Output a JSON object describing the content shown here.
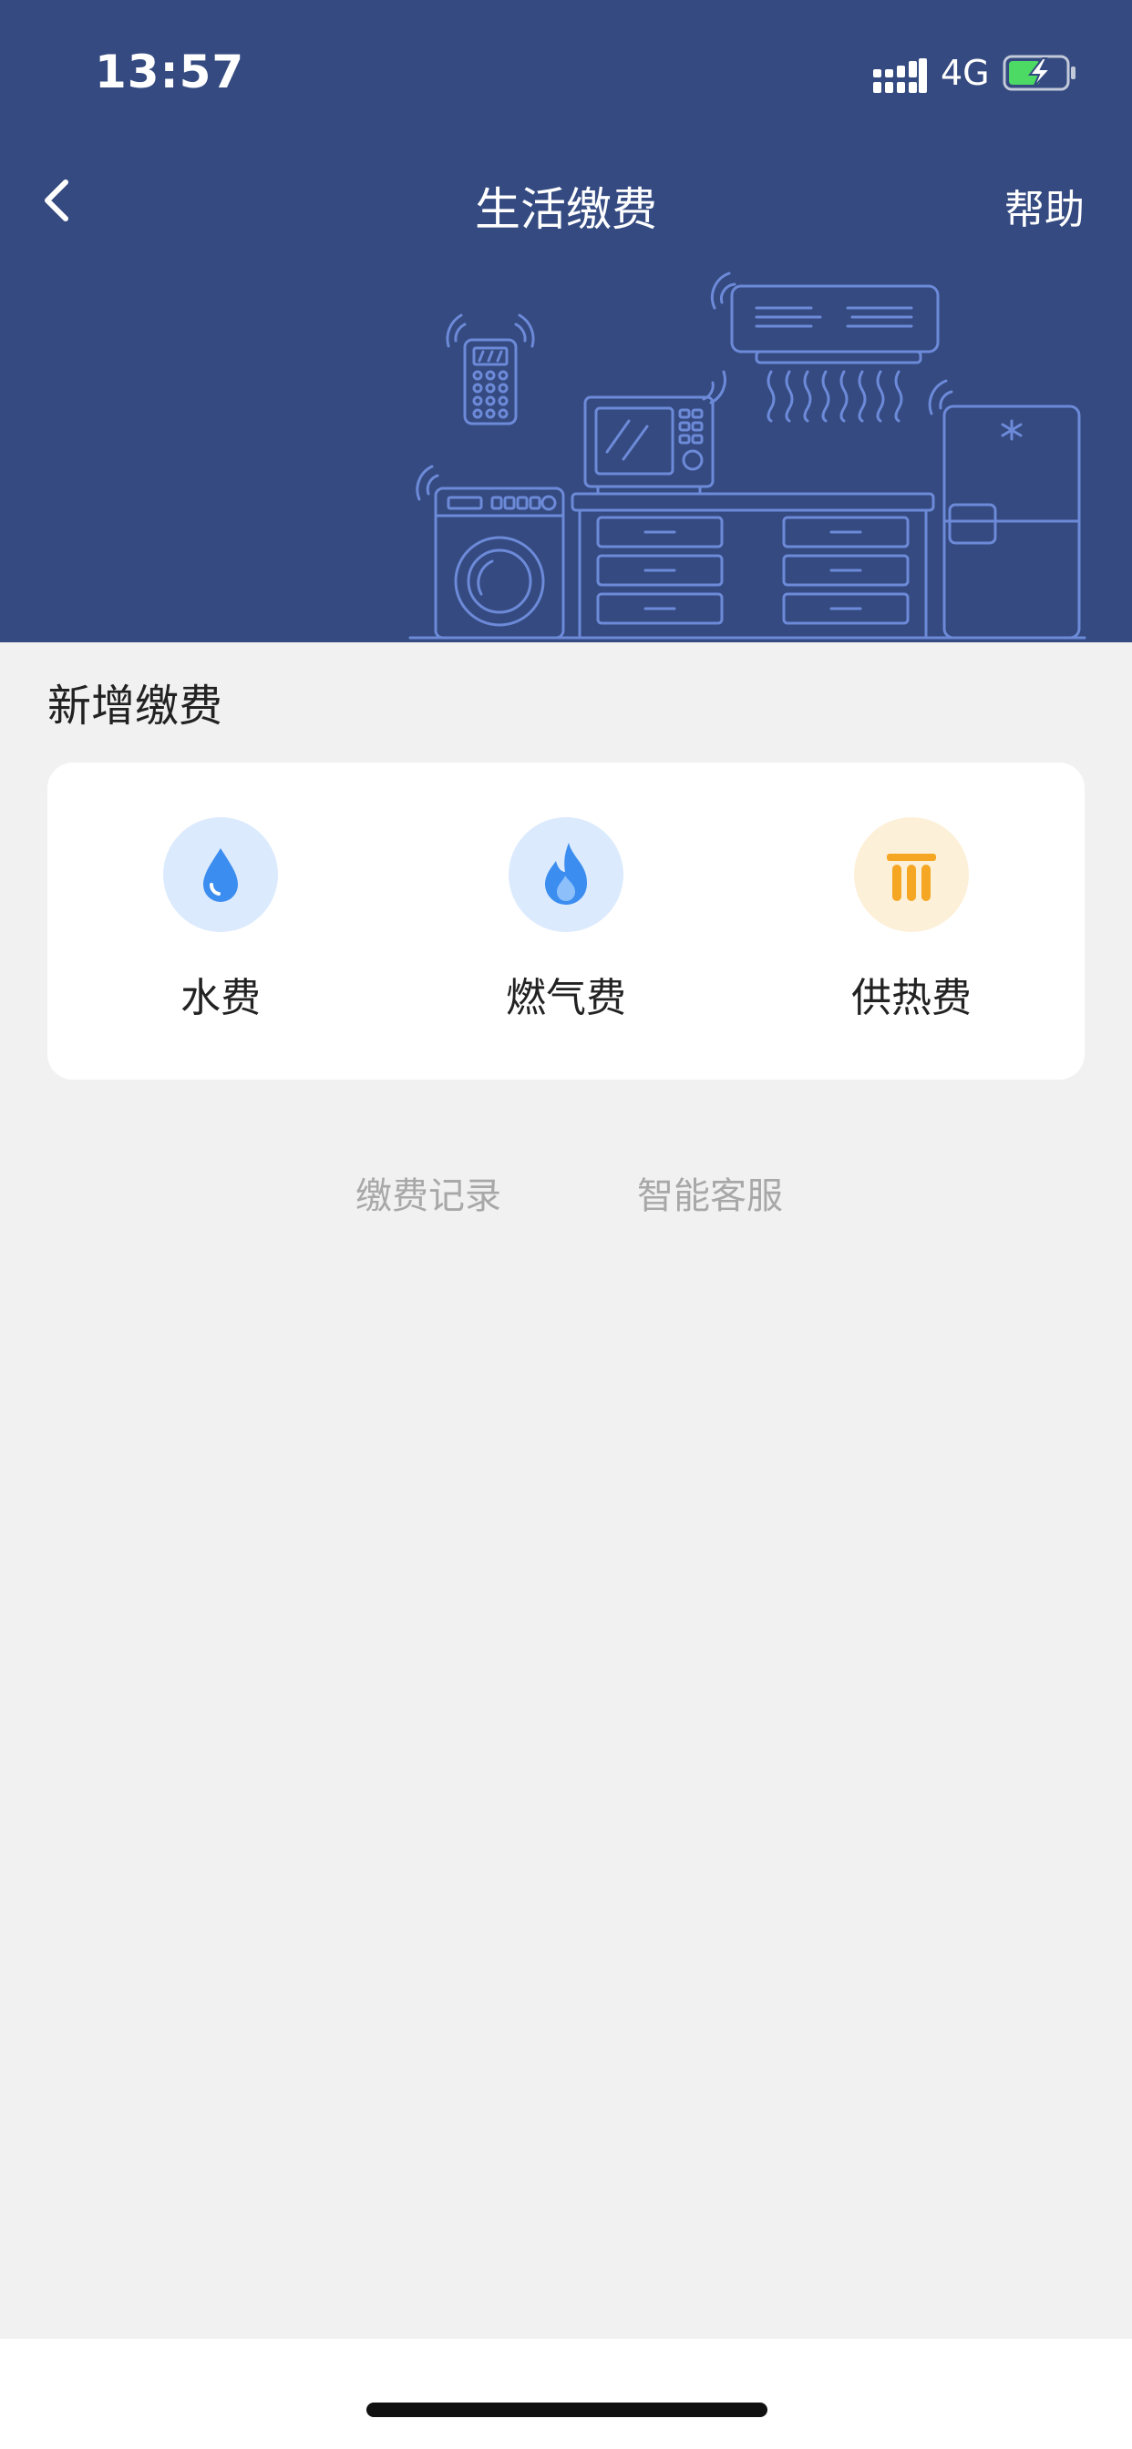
{
  "status_bar": {
    "time": "13:57",
    "network": "4G",
    "icons": [
      "signal-icon",
      "battery-charging-icon"
    ]
  },
  "nav": {
    "title": "生活缴费",
    "help": "帮助",
    "back_icon": "chevron-left-icon"
  },
  "section": {
    "title": "新增缴费"
  },
  "services": [
    {
      "label": "水费",
      "icon": "water-drop-icon",
      "color": "#3b8df0",
      "bg": "#dbeafd"
    },
    {
      "label": "燃气费",
      "icon": "flame-icon",
      "color": "#3b8df0",
      "bg": "#dbeafd"
    },
    {
      "label": "供热费",
      "icon": "heater-icon",
      "color": "#f5a623",
      "bg": "#fdf0d8"
    }
  ],
  "links": {
    "records": "缴费记录",
    "support": "智能客服"
  },
  "colors": {
    "header_bg": "#344a80",
    "page_bg": "#f1f1f1",
    "illustration_line": "#6d8ad9"
  }
}
